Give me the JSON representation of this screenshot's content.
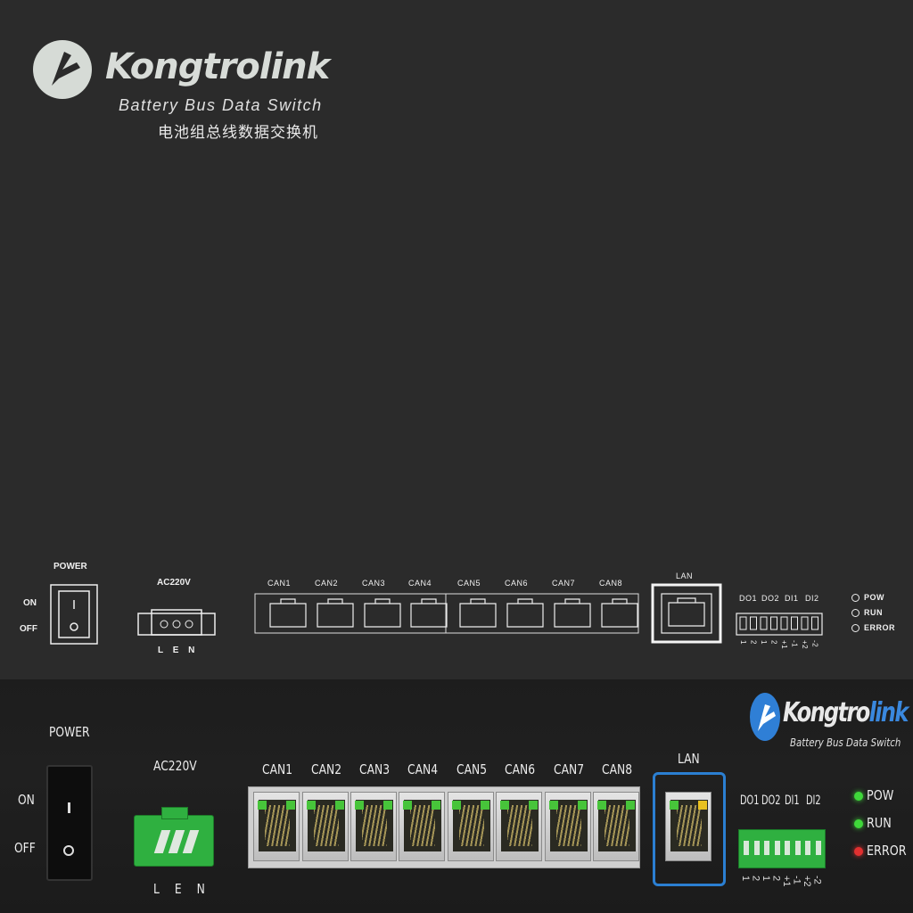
{
  "brand": {
    "name_prefix": "Kongtro",
    "name_suffix": "link",
    "product_en": "Battery Bus Data Switch",
    "product_cn": "电池组总线数据交换机"
  },
  "panel": {
    "power_label": "POWER",
    "switch_on": "ON",
    "switch_off": "OFF",
    "ac_label": "AC220V",
    "ac_pins": "L  E  N",
    "can_ports": [
      "CAN1",
      "CAN2",
      "CAN3",
      "CAN4",
      "CAN5",
      "CAN6",
      "CAN7",
      "CAN8"
    ],
    "lan_label": "LAN",
    "io_labels": [
      "DO1",
      "DO2",
      "DI1",
      "DI2"
    ],
    "io_pins": [
      "1",
      "2",
      "1",
      "2",
      "+1",
      "-1",
      "+2",
      "-2"
    ],
    "indicators": [
      {
        "label": "POW",
        "color": "#3fd83a"
      },
      {
        "label": "RUN",
        "color": "#3fd83a"
      },
      {
        "label": "ERROR",
        "color": "#e23030"
      }
    ]
  },
  "colors": {
    "background": "#2b2b2b",
    "logo_blue": "#2f7fd6",
    "led_green": "#47c43a",
    "led_yellow": "#e8c020",
    "lan_frame": "#2b7fd2",
    "terminal_green": "#2fb040"
  }
}
